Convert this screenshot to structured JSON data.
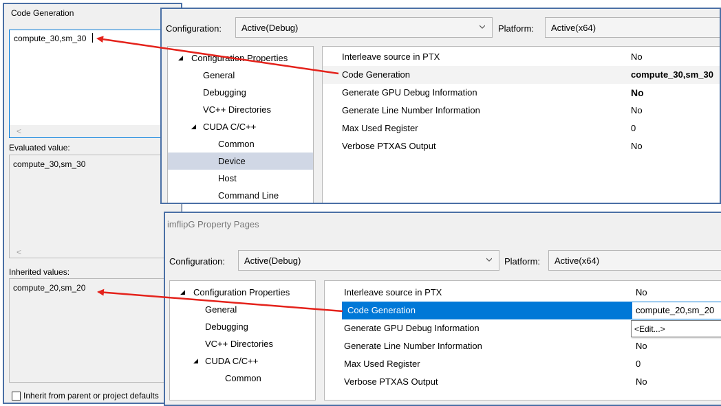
{
  "editor": {
    "title": "Code Generation",
    "value": "compute_30,sm_30",
    "evaluated_label": "Evaluated value:",
    "evaluated_value": "compute_30,sm_30",
    "inherited_label": "Inherited values:",
    "inherited_value": "compute_20,sm_20",
    "inherit_checkbox_label": "Inherit from parent or project defaults",
    "scroll_left": "<"
  },
  "top_dialog": {
    "configuration_label": "Configuration:",
    "configuration_value": "Active(Debug)",
    "platform_label": "Platform:",
    "platform_value": "Active(x64)",
    "tree": [
      {
        "label": "Configuration Properties",
        "expander": "◢"
      },
      {
        "label": "General"
      },
      {
        "label": "Debugging"
      },
      {
        "label": "VC++ Directories"
      },
      {
        "label": "CUDA C/C++",
        "expander": "◢"
      },
      {
        "label": "Common"
      },
      {
        "label": "Device"
      },
      {
        "label": "Host"
      },
      {
        "label": "Command Line"
      }
    ],
    "properties": [
      {
        "name": "Interleave source in PTX",
        "value": "No"
      },
      {
        "name": "Code Generation",
        "value": "compute_30,sm_30"
      },
      {
        "name": "Generate GPU Debug Information",
        "value": "No"
      },
      {
        "name": "Generate Line Number Information",
        "value": "No"
      },
      {
        "name": "Max Used Register",
        "value": "0"
      },
      {
        "name": "Verbose PTXAS Output",
        "value": "No"
      }
    ]
  },
  "bottom_dialog": {
    "title": "imflipG Property Pages",
    "configuration_label": "Configuration:",
    "configuration_value": "Active(Debug)",
    "platform_label": "Platform:",
    "platform_value": "Active(x64)",
    "tree": [
      {
        "label": "Configuration Properties",
        "expander": "◢"
      },
      {
        "label": "General"
      },
      {
        "label": "Debugging"
      },
      {
        "label": "VC++ Directories"
      },
      {
        "label": "CUDA C/C++",
        "expander": "◢"
      },
      {
        "label": "Common"
      }
    ],
    "properties": [
      {
        "name": "Interleave source in PTX",
        "value": "No"
      },
      {
        "name": "Code Generation",
        "value": "compute_20,sm_20"
      },
      {
        "name": "Generate GPU Debug Information",
        "value": ""
      },
      {
        "name": "Generate Line Number Information",
        "value": "No"
      },
      {
        "name": "Max Used Register",
        "value": "0"
      },
      {
        "name": "Verbose PTXAS Output",
        "value": "No"
      }
    ],
    "dropdown_edit": "<Edit...>"
  },
  "colors": {
    "accent_blue": "#0078d7",
    "selection_gray": "#d0d7e5",
    "arrow_red": "#e4221b",
    "frame_blue": "#4a6fa5"
  }
}
